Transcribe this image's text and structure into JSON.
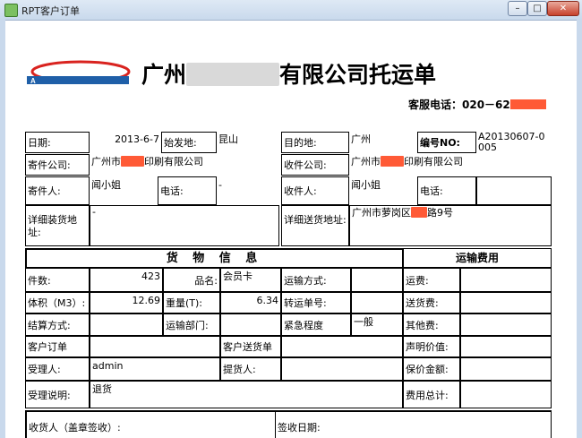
{
  "window": {
    "title": "RPT客户订单",
    "min_glyph": "–",
    "max_glyph": "□",
    "close_glyph": "✕"
  },
  "header": {
    "title_prefix": "广州",
    "title_suffix": "有限公司托运单",
    "phone": "客服电话：020－62"
  },
  "labels": {
    "date": "日期:",
    "origin": "始发地:",
    "dest": "目的地:",
    "no": "编号NO:",
    "sender_company": "寄件公司:",
    "receiver_company": "收件公司:",
    "sender": "寄件人:",
    "phone": "电话:",
    "receiver": "收件人:",
    "pickup_addr": "详细装货地址:",
    "delivery_addr": "详细送货地址:",
    "goods_info": "货 物 信 息",
    "freight": "运输费用",
    "pieces": "件数:",
    "product": "品名:",
    "transport_mode": "运输方式:",
    "freight_fee": "运费:",
    "volume": "体积（M3）:",
    "weight": "重量(T):",
    "transfer_no": "转运单号:",
    "delivery_fee": "送货费:",
    "settle": "结算方式:",
    "transport_dept": "运输部门:",
    "urgency": "紧急程度",
    "other_fee": "其他费:",
    "cust_order": "客户订单",
    "cust_delivery": "客户送货单",
    "declared": "声明价值:",
    "handler": "受理人:",
    "picker": "提货人:",
    "insured": "保价金额:",
    "handle_note": "受理说明:",
    "total_fee": "费用总计:",
    "consignee_sign": "收货人（盖章签收）:",
    "sign_date": "签收日期:"
  },
  "values": {
    "date": "2013-6-7",
    "origin": "昆山",
    "dest": "广州",
    "no": "A20130607-0005",
    "sender_company_pre": "广州市",
    "sender_company_post": "印刷有限公司",
    "receiver_company_pre": "广州市",
    "receiver_company_post": "印刷有限公司",
    "sender": "闻小姐",
    "sender_phone": "-",
    "receiver": "闻小姐",
    "pickup_addr": "-",
    "delivery_addr": "广州市萝岗区",
    "delivery_addr_tail": "路9号",
    "pieces": "423",
    "product": "会员卡",
    "volume": "12.69",
    "weight": "6.34",
    "urgency": "一般",
    "handler": "admin",
    "handle_note": "退货"
  }
}
